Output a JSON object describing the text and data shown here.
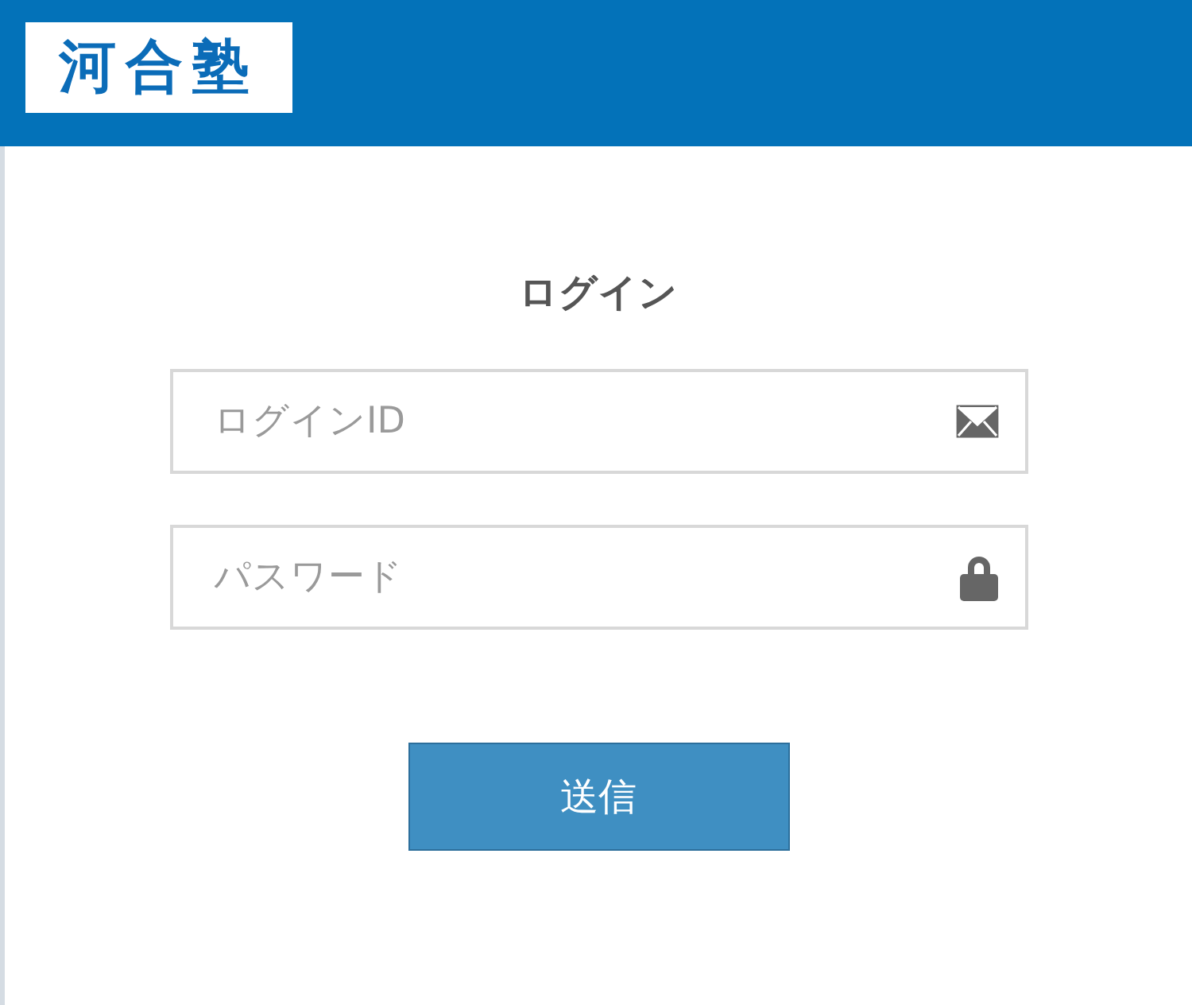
{
  "header": {
    "logo": "河合塾"
  },
  "login": {
    "title": "ログイン",
    "fields": [
      {
        "kind": "email",
        "placeholder": "ログインID"
      },
      {
        "kind": "password",
        "placeholder": "パスワード"
      }
    ],
    "submit": "送信"
  }
}
